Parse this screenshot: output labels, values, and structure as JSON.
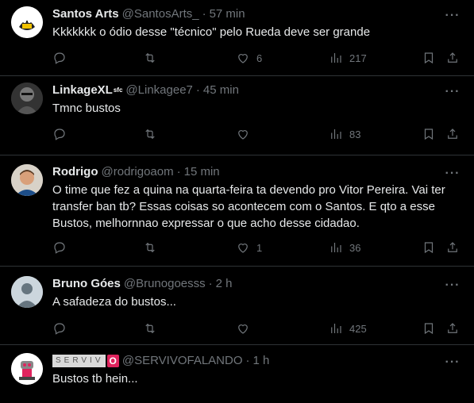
{
  "tweets": [
    {
      "name": "Santos Arts",
      "handle": "@SantosArts_",
      "dot": "·",
      "time": "57 min",
      "text": "Kkkkkkk o ódio desse \"técnico\" pelo Rueda deve ser grande",
      "likes": "6",
      "views": "217",
      "avatar_bg": "#ffffff"
    },
    {
      "name": "LinkageXL",
      "badge": "sfc",
      "handle": "@Linkagee7",
      "dot": "·",
      "time": "45 min",
      "text": "Tmnc bustos",
      "likes": "",
      "views": "83",
      "avatar_bg": "#2b2b2b"
    },
    {
      "name": "Rodrigo",
      "handle": "@rodrigoaom",
      "dot": "·",
      "time": "15 min",
      "text": "O time que fez a quina na quarta-feira ta devendo pro Vitor Pereira. Vai ter\ntransfer ban tb? Essas coisas so acontecem com o Santos. E qto a esse\nBustos, melhornnao expressar o que acho desse cidadao.",
      "likes": "1",
      "views": "36",
      "avatar_bg": "#c9c2b8"
    },
    {
      "name": "Bruno Góes",
      "handle": "@Brunogoesss",
      "dot": "·",
      "time": "2 h",
      "text": "A safadeza do bustos...",
      "likes": "",
      "views": "425",
      "avatar_bg": "#ccd6dd"
    },
    {
      "name_letters": "SERVIV",
      "name_o": "O",
      "handle": "@SERVIVOFALANDO",
      "dot": "·",
      "time": "1 h",
      "text": "Bustos tb hein...",
      "likes": "",
      "views": "",
      "avatar_bg": "#ffffff"
    }
  ],
  "more_label": "···",
  "colors": {
    "background": "#000000",
    "text": "#e7e9ea",
    "muted": "#71767b",
    "divider": "#2f3336"
  },
  "icons": [
    "reply-icon",
    "retweet-icon",
    "like-icon",
    "views-icon",
    "bookmark-icon",
    "share-icon",
    "more-icon"
  ]
}
